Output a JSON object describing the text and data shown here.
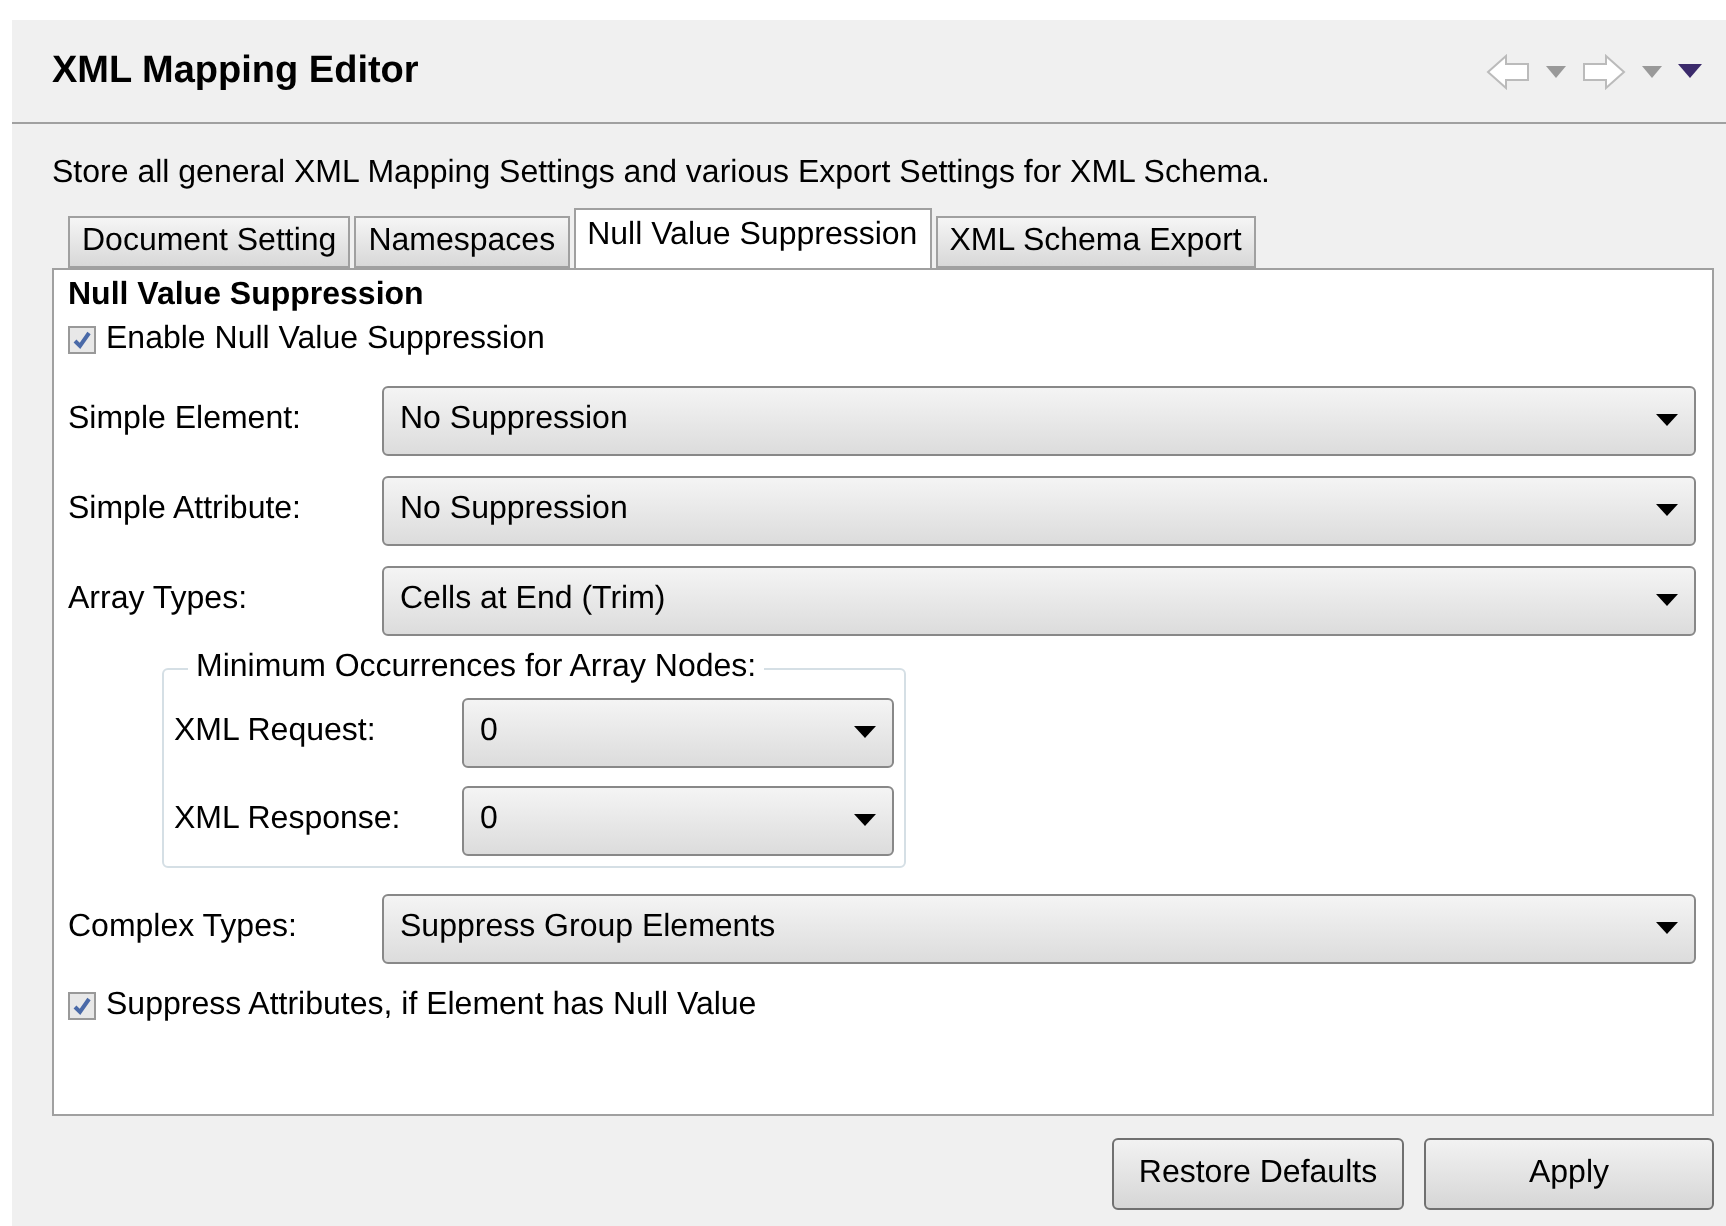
{
  "window": {
    "title": "XML Mapping Editor"
  },
  "description": "Store all general XML Mapping Settings and various Export Settings for XML Schema.",
  "tabs": [
    {
      "label": "Document Setting",
      "selected": false
    },
    {
      "label": "Namespaces",
      "selected": false
    },
    {
      "label": "Null Value Suppression",
      "selected": true
    },
    {
      "label": "XML Schema Export",
      "selected": false
    }
  ],
  "section_title": "Null Value Suppression",
  "enable_checkbox": {
    "label": "Enable Null Value Suppression",
    "checked": true
  },
  "combos": [
    {
      "label": "Simple Element:",
      "value": "No Suppression"
    },
    {
      "label": "Simple Attribute:",
      "value": "No Suppression"
    },
    {
      "label": "Array Types:",
      "value": "Cells at End (Trim)"
    }
  ],
  "group": {
    "title": "Minimum Occurrences for Array Nodes:",
    "combos": [
      {
        "label": "XML Request:",
        "value": "0"
      },
      {
        "label": "XML Response:",
        "value": "0"
      }
    ]
  },
  "complex_combo": {
    "label": "Complex Types:",
    "value": "Suppress Group Elements"
  },
  "attr_checkbox": {
    "label": "Suppress Attributes, if Element has Null Value",
    "checked": true
  },
  "buttons": [
    "Restore Defaults",
    "Apply"
  ]
}
